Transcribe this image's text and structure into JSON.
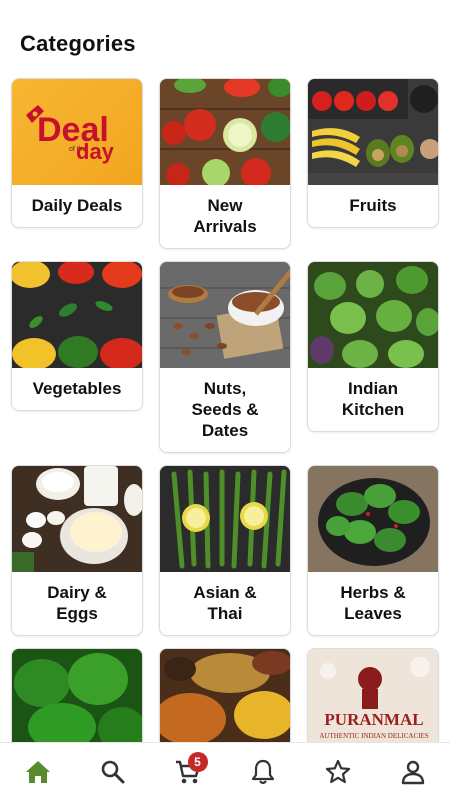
{
  "header": {
    "title": "Categories"
  },
  "categories": [
    {
      "label": "Daily Deals"
    },
    {
      "label": "New\nArrivals"
    },
    {
      "label": "Fruits"
    },
    {
      "label": "Vegetables"
    },
    {
      "label": "Nuts,\nSeeds &\nDates"
    },
    {
      "label": "Indian\nKitchen"
    },
    {
      "label": "Dairy &\nEggs"
    },
    {
      "label": "Asian &\nThai"
    },
    {
      "label": "Herbs &\nLeaves"
    }
  ],
  "deal_logo": {
    "big": "Deal",
    "of_the": "of the",
    "day": "day"
  },
  "puranmal_logo": {
    "name": "PURANMAL",
    "tagline": "AUTHENTIC INDIAN DELICACIES"
  },
  "bottom_nav": {
    "active_color": "#5a8a2b",
    "cart_badge": "5",
    "items": [
      "home-icon",
      "search-icon",
      "cart-icon",
      "bell-icon",
      "star-icon",
      "profile-icon"
    ]
  }
}
